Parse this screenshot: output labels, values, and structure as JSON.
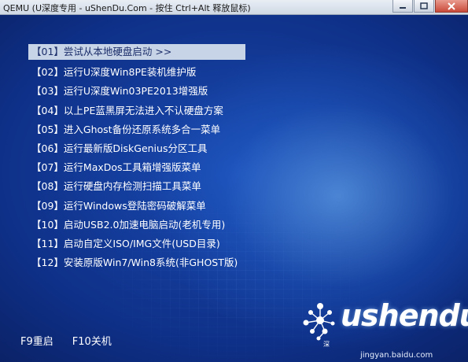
{
  "window": {
    "title": "QEMU (U深度专用 - uShenDu.Com - 按住 Ctrl+Alt 释放鼠标)"
  },
  "menu": {
    "selected_index": 0,
    "items": [
      {
        "label": "【01】尝试从本地硬盘启动 >>"
      },
      {
        "label": "【02】运行U深度Win8PE装机维护版"
      },
      {
        "label": "【03】运行U深度Win03PE2013增强版"
      },
      {
        "label": "【04】以上PE蓝黑屏无法进入不认硬盘方案"
      },
      {
        "label": "【05】进入Ghost备份还原系统多合一菜单"
      },
      {
        "label": "【06】运行最新版DiskGenius分区工具"
      },
      {
        "label": "【07】运行MaxDos工具箱增强版菜单"
      },
      {
        "label": "【08】运行硬盘内存检测扫描工具菜单"
      },
      {
        "label": "【09】运行Windows登陆密码破解菜单"
      },
      {
        "label": "【10】启动USB2.0加速电脑启动(老机专用)"
      },
      {
        "label": "【11】启动自定义ISO/IMG文件(USD目录)"
      },
      {
        "label": "【12】安装原版Win7/Win8系统(非GHOST版)"
      }
    ]
  },
  "function_keys": {
    "f9": "F9重启",
    "f10": "F10关机"
  },
  "logo": {
    "text": "ushendu",
    "subtitle": "深"
  },
  "watermark": "jingyan.baidu.com",
  "icons": {
    "minimize": "minimize-icon",
    "maximize": "maximize-icon",
    "close": "close-icon",
    "logo_mark": "ushendu-logo-icon"
  }
}
